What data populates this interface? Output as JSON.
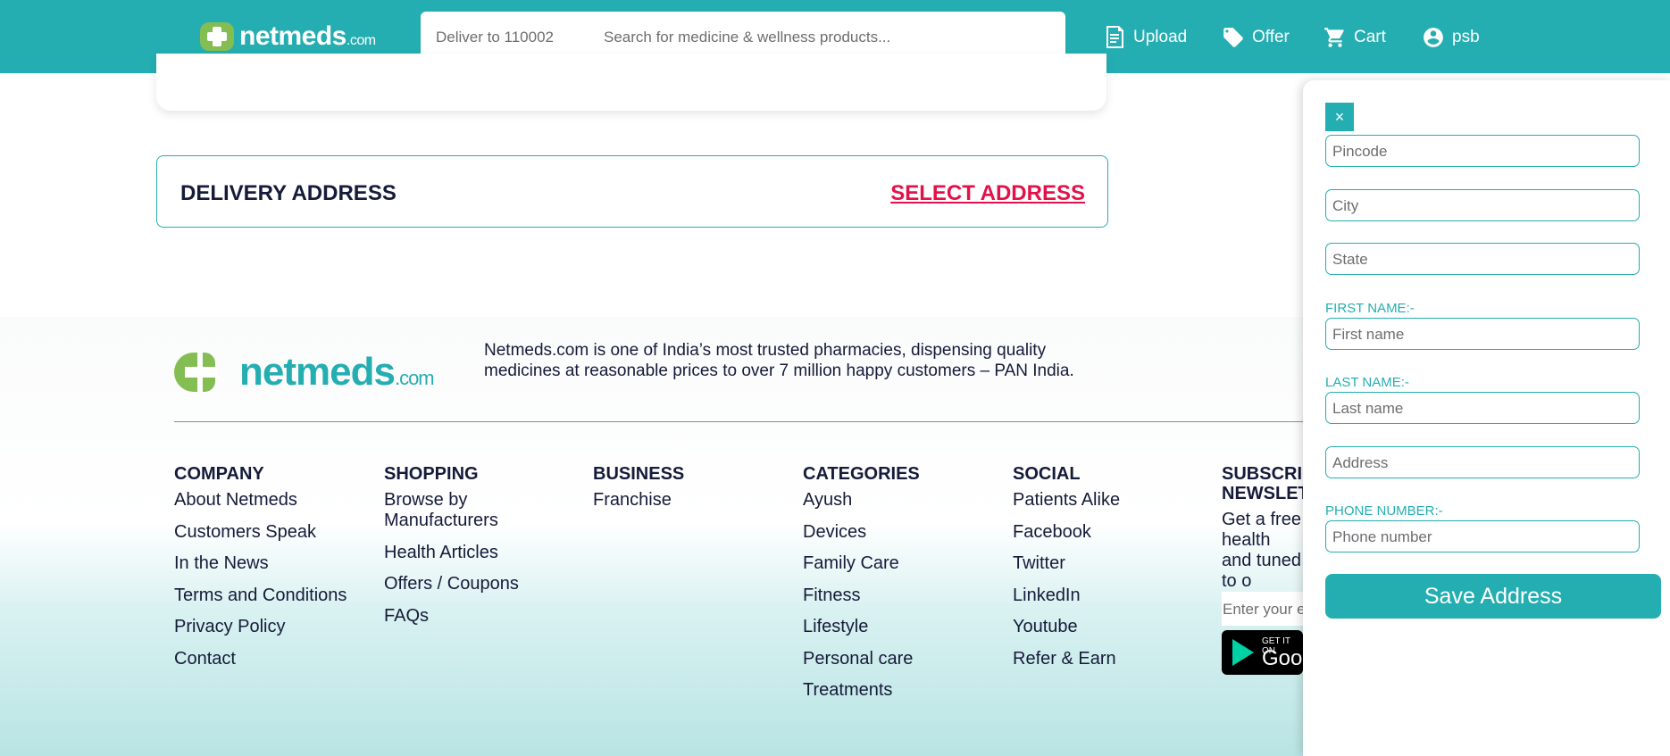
{
  "header": {
    "logo_text": "netmeds",
    "logo_suffix": ".com",
    "deliver_to": "Deliver to 110002",
    "search_placeholder": "Search for medicine & wellness products...",
    "nav": {
      "upload": "Upload",
      "offer": "Offer",
      "cart": "Cart",
      "user": "psb"
    },
    "icons": [
      "upload-icon",
      "offer-tag-icon",
      "cart-icon",
      "user-avatar-icon"
    ]
  },
  "delivery": {
    "title": "DELIVERY ADDRESS",
    "action": "SELECT ADDRESS"
  },
  "footer": {
    "logo_text": "netmeds",
    "logo_suffix": ".com",
    "about": "Netmeds.com is one of India’s most trusted pharmacies, dispensing quality medicines at reasonable prices to over 7 million happy customers – PAN India.",
    "columns": {
      "company": {
        "title": "COMPANY",
        "items": [
          "About Netmeds",
          "Customers Speak",
          "In the News",
          "Terms and Conditions",
          "Privacy Policy",
          "Contact"
        ]
      },
      "shopping": {
        "title": "SHOPPING",
        "items": [
          "Browse by Manufacturers",
          "Health Articles",
          "Offers / Coupons",
          "FAQs"
        ]
      },
      "business": {
        "title": "BUSINESS",
        "items": [
          "Franchise"
        ]
      },
      "categories": {
        "title": "CATEGORIES",
        "items": [
          "Ayush",
          "Devices",
          "Family Care",
          "Fitness",
          "Lifestyle",
          "Personal care",
          "Treatments"
        ]
      },
      "social": {
        "title": "SOCIAL",
        "items": [
          "Patients Alike",
          "Facebook",
          "Twitter",
          "LinkedIn",
          "Youtube",
          "Refer & Earn"
        ]
      },
      "newsletter": {
        "title": "SUBSCRI NEWSLET",
        "text": "Get a free health and tuned to o",
        "email_placeholder": "Enter your e",
        "gplay_top": "GET IT ON",
        "gplay_main": "Goog"
      }
    }
  },
  "address_panel": {
    "close": "×",
    "pincode_placeholder": "Pincode",
    "city_placeholder": "City",
    "state_placeholder": "State",
    "first_name_label": "FIRST NAME:-",
    "first_name_placeholder": "First name",
    "last_name_label": "LAST NAME:-",
    "last_name_placeholder": "Last name",
    "address_placeholder": "Address",
    "phone_label": "PHONE NUMBER:-",
    "phone_placeholder": "Phone number",
    "save_button": "Save Address"
  },
  "colors": {
    "brand_teal": "#24aeb1",
    "brand_green": "#84be52",
    "accent_red": "#e3114a",
    "text_dark": "#151b39"
  }
}
